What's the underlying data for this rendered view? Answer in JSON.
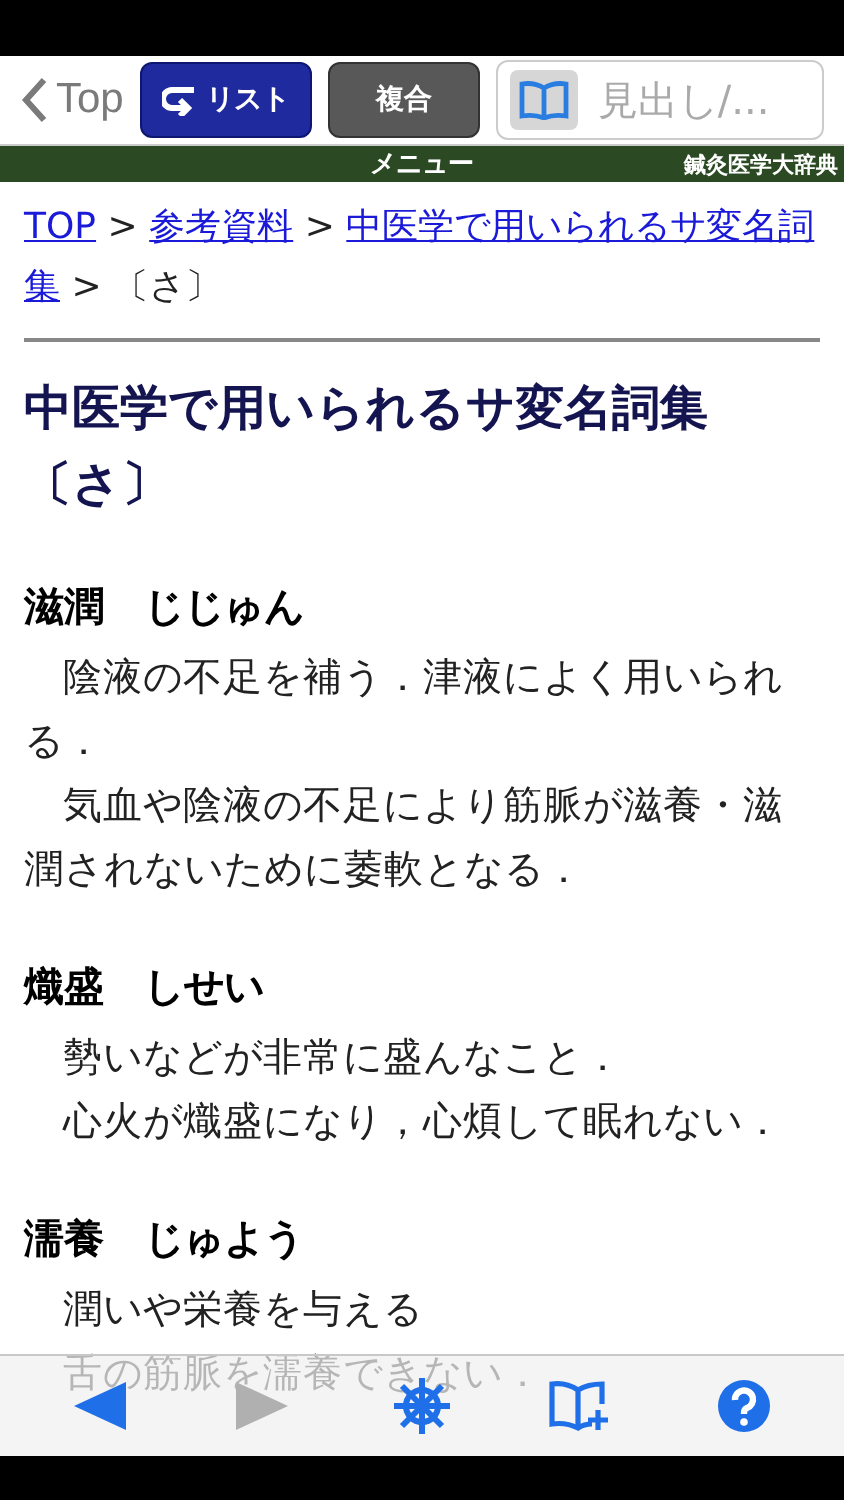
{
  "nav": {
    "back_label": "Top",
    "list_button": "リスト",
    "combo_button": "複合",
    "search": {
      "placeholder": "見出し/..."
    }
  },
  "menu_bar": {
    "title": "メニュー",
    "app_name": "鍼灸医学大辞典"
  },
  "breadcrumb": {
    "separator": ">",
    "items": [
      {
        "kind": "link",
        "lines": [
          "TOP"
        ]
      },
      {
        "kind": "link",
        "lines": [
          "参考資料"
        ]
      },
      {
        "kind": "link",
        "lines": [
          "中医学で用いられるサ変名詞",
          "集"
        ]
      },
      {
        "kind": "current",
        "lines": [
          "〔さ〕"
        ]
      }
    ]
  },
  "title": "中医学で用いられるサ変名詞集〔さ〕",
  "entries": [
    {
      "heading": "滋潤　じじゅん",
      "paragraphs": [
        "陰液の不足を補う．津液によく用いられる．",
        "気血や陰液の不足により筋脈が滋養・滋潤されないために萎軟となる．"
      ]
    },
    {
      "heading": "熾盛　しせい",
      "paragraphs": [
        "勢いなどが非常に盛んなこと．",
        "心火が熾盛になり，心煩して眠れない．"
      ]
    },
    {
      "heading": "濡養　じゅよう",
      "paragraphs": [
        "潤いや栄養を与える",
        "舌の筋脈を濡養できない．"
      ]
    }
  ],
  "toolbar": [
    {
      "kind": "back",
      "disabled": false
    },
    {
      "kind": "forward",
      "disabled": true
    },
    {
      "kind": "wheel",
      "disabled": false
    },
    {
      "kind": "bookmark-add",
      "disabled": false
    },
    {
      "kind": "help",
      "disabled": false
    }
  ]
}
